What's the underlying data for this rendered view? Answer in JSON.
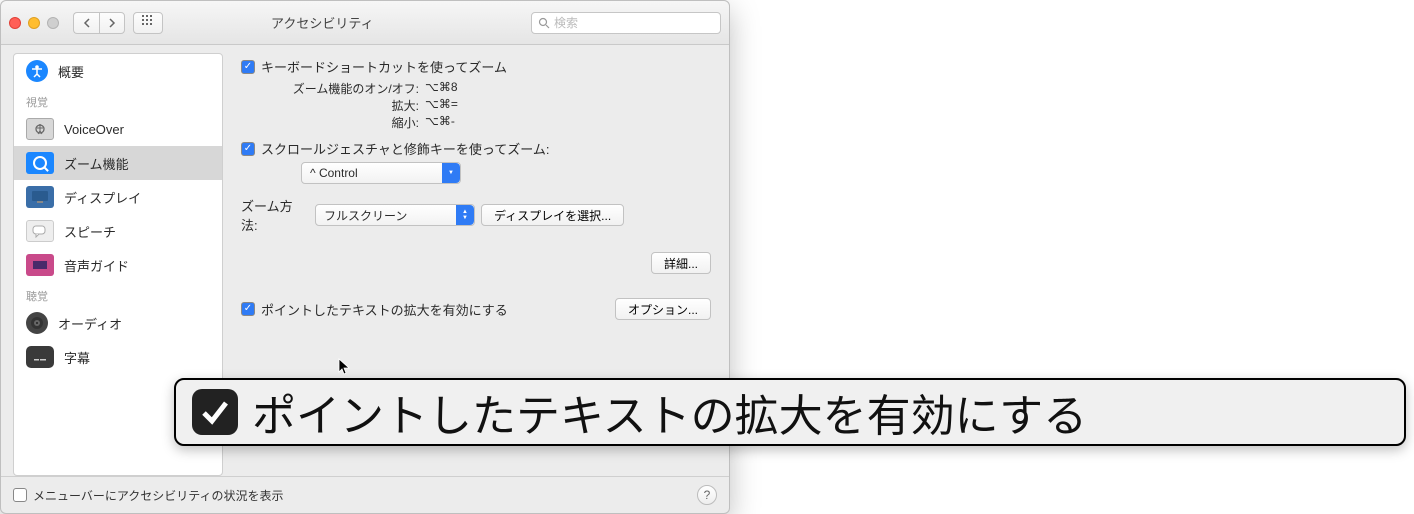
{
  "titlebar": {
    "title": "アクセシビリティ",
    "search_placeholder": "検索"
  },
  "sidebar": {
    "overview": "概要",
    "section_vision": "視覚",
    "voiceover": "VoiceOver",
    "zoom": "ズーム機能",
    "display": "ディスプレイ",
    "speech": "スピーチ",
    "audiodesc": "音声ガイド",
    "section_hearing": "聴覚",
    "audio": "オーディオ",
    "captions": "字幕"
  },
  "content": {
    "kb_shortcut_zoom": "キーボードショートカットを使ってズーム",
    "toggle_zoom_label": "ズーム機能のオン/オフ:",
    "toggle_zoom_value": "⌥⌘8",
    "zoom_in_label": "拡大:",
    "zoom_in_value": "⌥⌘=",
    "zoom_out_label": "縮小:",
    "zoom_out_value": "⌥⌘-",
    "scroll_gesture_zoom": "スクロールジェスチャと修飾キーを使ってズーム:",
    "modifier_key": "^ Control",
    "zoom_style_label": "ズーム方法:",
    "zoom_style_value": "フルスクリーン",
    "choose_display": "ディスプレイを選択...",
    "advanced": "詳細...",
    "hover_text_enable": "ポイントしたテキストの拡大を有効にする",
    "options": "オプション..."
  },
  "footer": {
    "menu_bar_status": "メニューバーにアクセシビリティの状況を表示"
  },
  "overlay": {
    "text": "ポイントしたテキストの拡大を有効にする"
  }
}
